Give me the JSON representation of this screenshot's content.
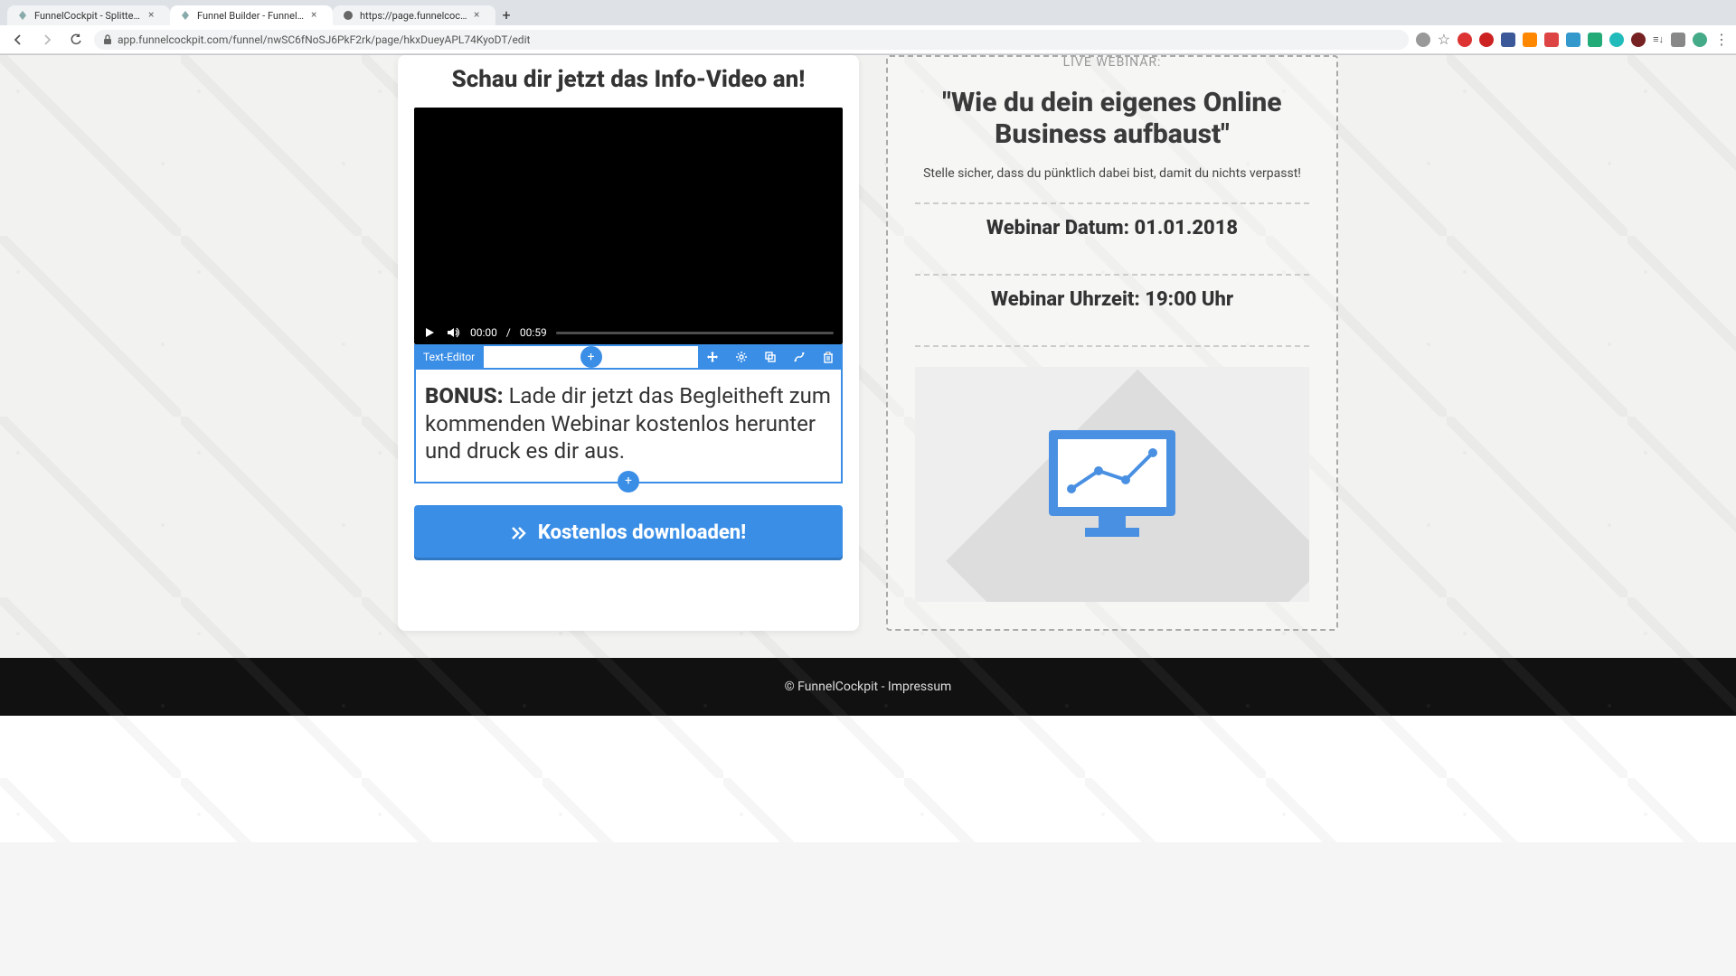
{
  "browser": {
    "tabs": [
      {
        "title": "FunnelCockpit - Splittests, Ma"
      },
      {
        "title": "Funnel Builder - FunnelCockpit"
      },
      {
        "title": "https://page.funnelcockpit.co"
      }
    ],
    "url": "app.funnelcockpit.com/funnel/nwSC6fNoSJ6PkF2rk/page/hkxDueyAPL74KyoDT/edit"
  },
  "left": {
    "heading": "Schau dir jetzt das Info-Video an!",
    "video": {
      "current": "00:00",
      "sep": "/",
      "total": "00:59"
    },
    "toolbar_label": "Text-Editor",
    "bonus_label": "BONUS:",
    "bonus_text": " Lade dir jetzt das Begleitheft zum kommenden Webinar kostenlos herunter und druck es dir aus.",
    "cta": "Kostenlos downloaden!"
  },
  "right": {
    "eyebrow": "LIVE WEBINAR:",
    "title": "\"Wie du dein eigenes Online Business aufbaust\"",
    "subtitle": "Stelle sicher, dass du pünktlich dabei bist, damit du nichts verpasst!",
    "date_line": "Webinar Datum: 01.01.2018",
    "time_line": "Webinar Uhrzeit: 19:00 Uhr"
  },
  "footer": {
    "text": "© FunnelCockpit - Impressum"
  }
}
